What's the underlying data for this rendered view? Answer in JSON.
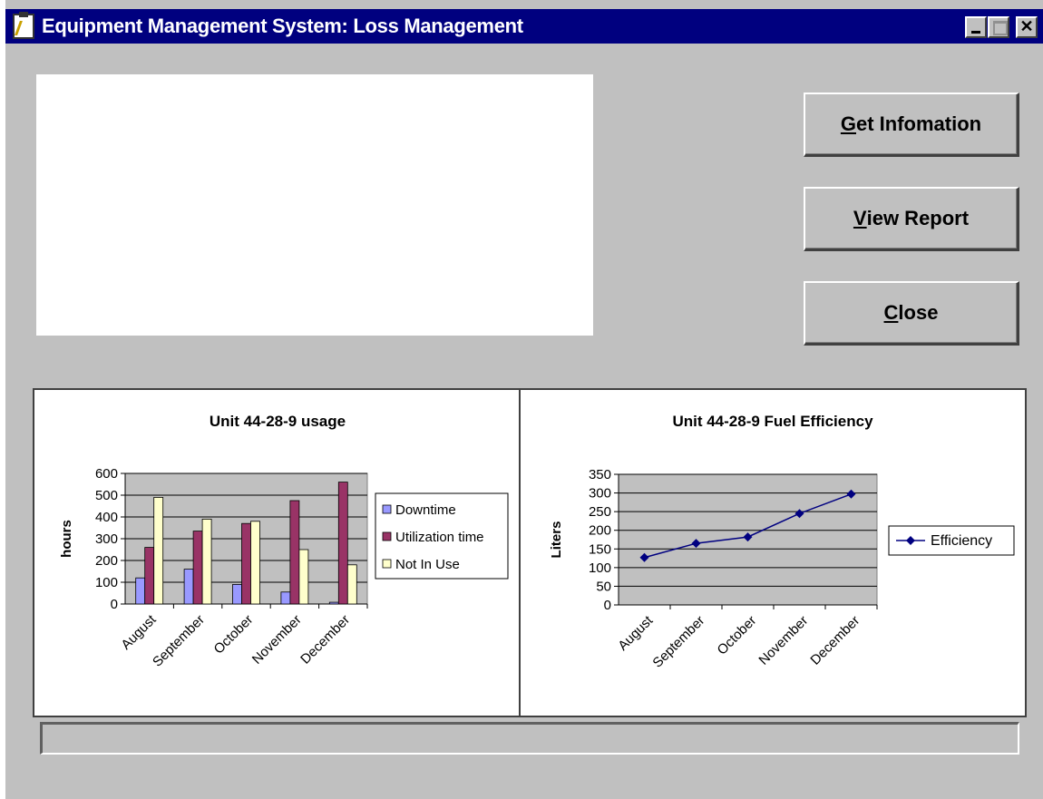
{
  "window": {
    "title": "Equipment Management System: Loss  Management"
  },
  "buttons": {
    "get_info": {
      "mnemonic": "G",
      "rest": "et Infomation"
    },
    "view_report": {
      "mnemonic": "V",
      "rest": "iew Report"
    },
    "close": {
      "mnemonic": "C",
      "rest": "lose"
    }
  },
  "info_panel": {
    "text": ""
  },
  "status_bar": {
    "text": ""
  },
  "chart_data": [
    {
      "type": "bar",
      "title": "Unit 44-28-9 usage",
      "xlabel": "",
      "ylabel": "hours",
      "categories": [
        "August",
        "September",
        "October",
        "November",
        "December"
      ],
      "ylim": [
        0,
        600
      ],
      "yticks": [
        "0",
        "100",
        "200",
        "300",
        "400",
        "500",
        "600"
      ],
      "grid": true,
      "legend_position": "right",
      "series": [
        {
          "name": "Downtime",
          "values": [
            120,
            160,
            90,
            55,
            8
          ],
          "color": "#9999ff"
        },
        {
          "name": "Utilization time",
          "values": [
            260,
            335,
            370,
            475,
            560
          ],
          "color": "#993366"
        },
        {
          "name": "Not In Use",
          "values": [
            490,
            390,
            380,
            250,
            180
          ],
          "color": "#ffffcc"
        }
      ],
      "plot_background": "#c0c0c0"
    },
    {
      "type": "line",
      "title": "Unit 44-28-9 Fuel Efficiency",
      "xlabel": "",
      "ylabel": "Liters",
      "categories": [
        "August",
        "September",
        "October",
        "November",
        "December"
      ],
      "ylim": [
        0,
        350
      ],
      "yticks": [
        "0",
        "50",
        "100",
        "150",
        "200",
        "250",
        "300",
        "350"
      ],
      "grid": true,
      "legend_position": "right",
      "series": [
        {
          "name": "Efficiency",
          "values": [
            127,
            165,
            182,
            245,
            297
          ],
          "color": "#000080"
        }
      ],
      "plot_background": "#c0c0c0"
    }
  ]
}
